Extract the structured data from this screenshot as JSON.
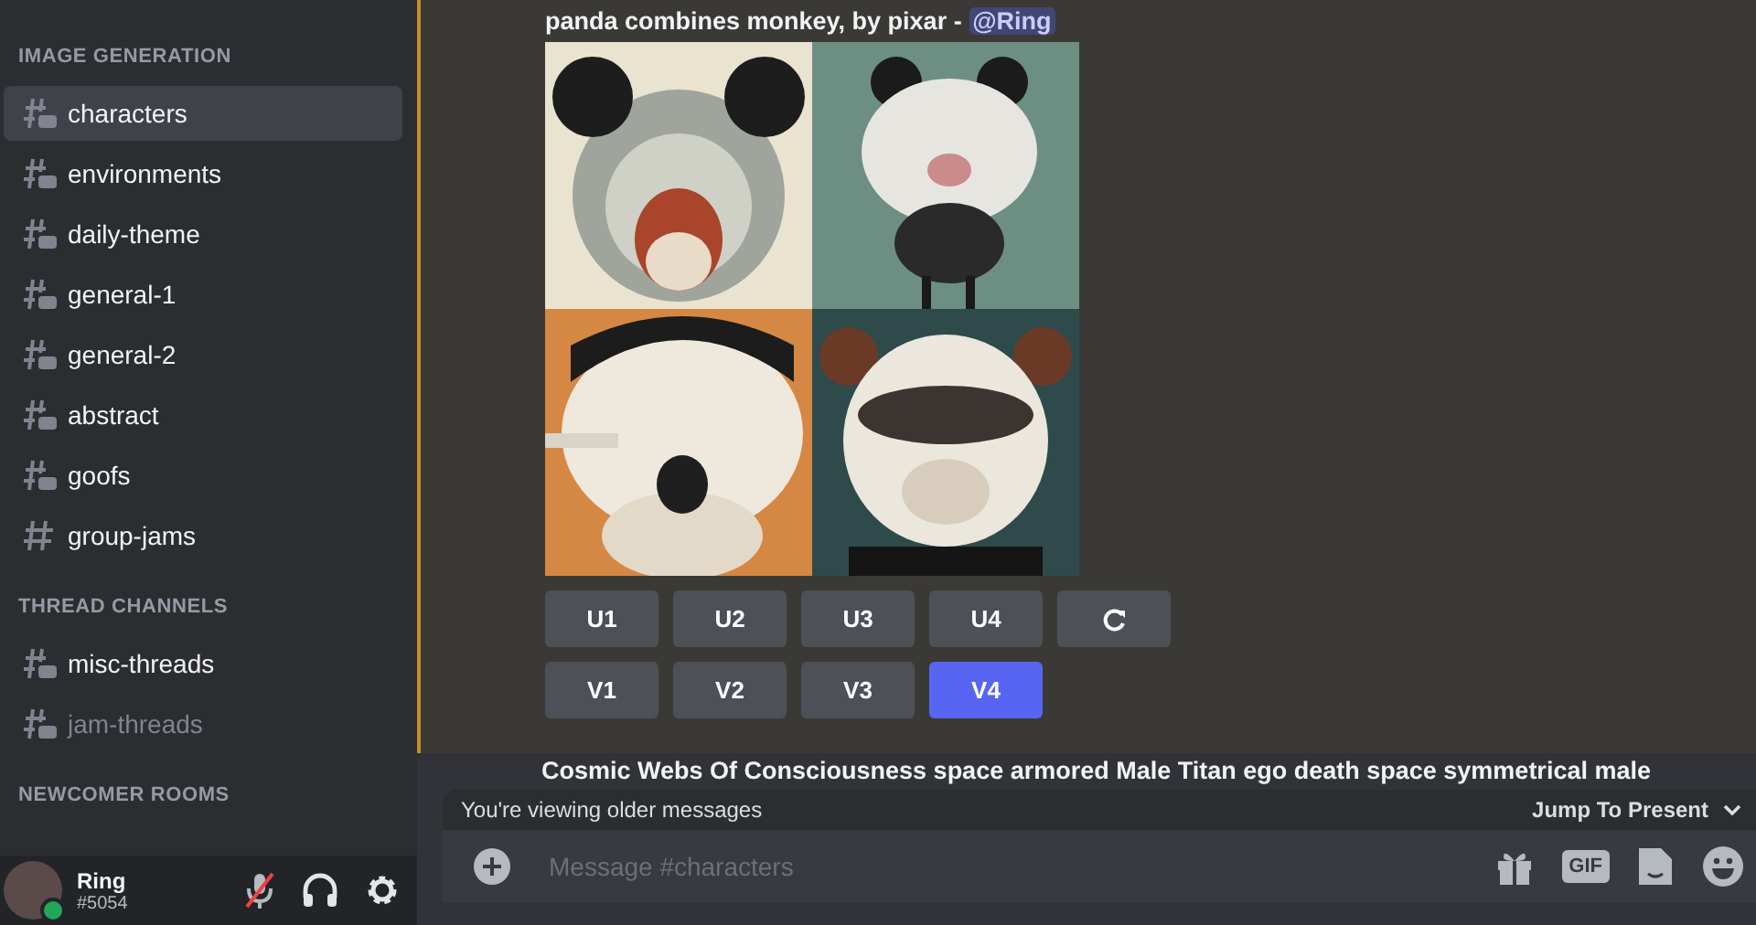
{
  "sidebar": {
    "categories": [
      {
        "title": "IMAGE GENERATION",
        "channels": [
          {
            "name": "characters",
            "kind": "thread",
            "selected": true,
            "unread": true
          },
          {
            "name": "environments",
            "kind": "thread",
            "selected": false,
            "unread": true
          },
          {
            "name": "daily-theme",
            "kind": "thread",
            "selected": false,
            "unread": true
          },
          {
            "name": "general-1",
            "kind": "thread",
            "selected": false,
            "unread": true
          },
          {
            "name": "general-2",
            "kind": "thread",
            "selected": false,
            "unread": true
          },
          {
            "name": "abstract",
            "kind": "thread",
            "selected": false,
            "unread": true
          },
          {
            "name": "goofs",
            "kind": "thread",
            "selected": false,
            "unread": true
          },
          {
            "name": "group-jams",
            "kind": "text",
            "selected": false,
            "unread": true
          }
        ]
      },
      {
        "title": "THREAD CHANNELS",
        "channels": [
          {
            "name": "misc-threads",
            "kind": "thread",
            "selected": false,
            "unread": true
          },
          {
            "name": "jam-threads",
            "kind": "thread",
            "selected": false,
            "unread": false
          }
        ]
      },
      {
        "title": "NEWCOMER ROOMS"
      }
    ]
  },
  "user": {
    "name": "Ring",
    "tag": "#5054",
    "online": true,
    "muted": true
  },
  "messages": [
    {
      "text": "panda combines monkey, by pixar - ",
      "mention": "@Ring",
      "highlighted": true,
      "buttons": [
        [
          {
            "kind": "label",
            "label": "U1",
            "selected": false
          },
          {
            "kind": "label",
            "label": "U2",
            "selected": false
          },
          {
            "kind": "label",
            "label": "U3",
            "selected": false
          },
          {
            "kind": "label",
            "label": "U4",
            "selected": false
          },
          {
            "kind": "reroll",
            "selected": false
          }
        ],
        [
          {
            "kind": "label",
            "label": "V1",
            "selected": false
          },
          {
            "kind": "label",
            "label": "V2",
            "selected": false
          },
          {
            "kind": "label",
            "label": "V3",
            "selected": false
          },
          {
            "kind": "label",
            "label": "V4",
            "selected": true
          }
        ]
      ]
    },
    {
      "text": "Cosmic Webs Of Consciousness space armored Male Titan ego death space symmetrical male",
      "highlighted": false
    }
  ],
  "older_notice": {
    "text": "You're viewing older messages",
    "action": "Jump To Present"
  },
  "composer": {
    "placeholder": "Message #characters",
    "gif_label": "GIF"
  }
}
